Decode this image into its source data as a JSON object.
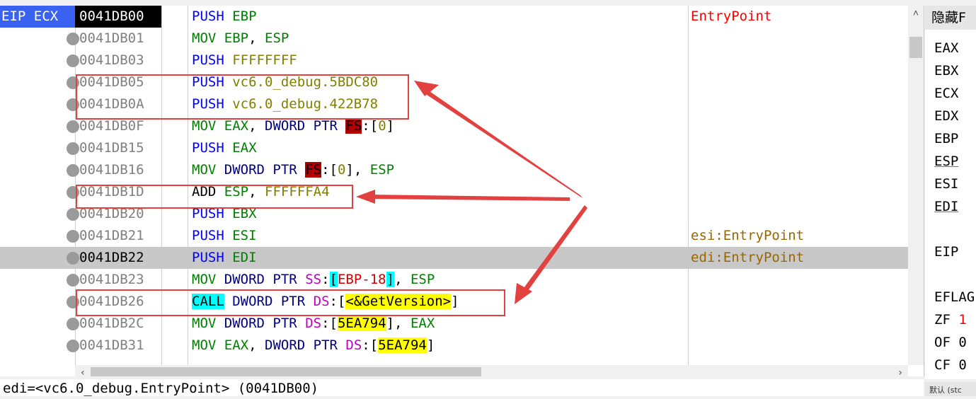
{
  "disasm": {
    "eip_label": "EIP ECX",
    "rows": [
      {
        "addr": "0041DB00",
        "parts": [
          [
            "PUSH",
            "kw"
          ],
          [
            " ",
            "blk"
          ],
          [
            "EBP",
            "reg"
          ]
        ],
        "comment": "EntryPoint",
        "comment_color": "red"
      },
      {
        "addr": "0041DB01",
        "parts": [
          [
            "MOV",
            "reg"
          ],
          [
            " ",
            "blk"
          ],
          [
            "EBP",
            "reg"
          ],
          [
            ", ",
            "blk"
          ],
          [
            "ESP",
            "reg"
          ]
        ],
        "comment": ""
      },
      {
        "addr": "0041DB03",
        "parts": [
          [
            "PUSH",
            "kw"
          ],
          [
            " ",
            "blk"
          ],
          [
            "FFFFFFFF",
            "num"
          ]
        ],
        "comment": ""
      },
      {
        "addr": "0041DB05",
        "parts": [
          [
            "PUSH",
            "kw"
          ],
          [
            " ",
            "blk"
          ],
          [
            "vc6.0_debug.5BDC80",
            "sym"
          ]
        ],
        "comment": ""
      },
      {
        "addr": "0041DB0A",
        "parts": [
          [
            "PUSH",
            "kw"
          ],
          [
            " ",
            "blk"
          ],
          [
            "vc6.0_debug.422B78",
            "sym"
          ]
        ],
        "comment": ""
      },
      {
        "addr": "0041DB0F",
        "parts": [
          [
            "MOV",
            "reg"
          ],
          [
            " ",
            "blk"
          ],
          [
            "EAX",
            "reg"
          ],
          [
            ", ",
            "blk"
          ],
          [
            "DWORD PTR",
            "ptr"
          ],
          [
            " ",
            "blk"
          ],
          [
            "FS",
            "fs"
          ],
          [
            ":[",
            "blk"
          ],
          [
            "0",
            "num"
          ],
          [
            "]",
            "blk"
          ]
        ],
        "comment": ""
      },
      {
        "addr": "0041DB15",
        "parts": [
          [
            "PUSH",
            "kw"
          ],
          [
            " ",
            "blk"
          ],
          [
            "EAX",
            "reg"
          ]
        ],
        "comment": ""
      },
      {
        "addr": "0041DB16",
        "parts": [
          [
            "MOV",
            "reg"
          ],
          [
            " ",
            "blk"
          ],
          [
            "DWORD PTR",
            "ptr"
          ],
          [
            " ",
            "blk"
          ],
          [
            "FS",
            "fs"
          ],
          [
            ":[",
            "blk"
          ],
          [
            "0",
            "num"
          ],
          [
            "], ",
            "blk"
          ],
          [
            "ESP",
            "reg"
          ]
        ],
        "comment": ""
      },
      {
        "addr": "0041DB1D",
        "parts": [
          [
            "ADD",
            "blk"
          ],
          [
            " ",
            "blk"
          ],
          [
            "ESP",
            "reg"
          ],
          [
            ", ",
            "blk"
          ],
          [
            "FFFFFFA4",
            "num"
          ]
        ],
        "comment": ""
      },
      {
        "addr": "0041DB20",
        "parts": [
          [
            "PUSH",
            "kw"
          ],
          [
            " ",
            "blk"
          ],
          [
            "EBX",
            "reg"
          ]
        ],
        "comment": ""
      },
      {
        "addr": "0041DB21",
        "parts": [
          [
            "PUSH",
            "kw"
          ],
          [
            " ",
            "blk"
          ],
          [
            "ESI",
            "reg"
          ]
        ],
        "comment": "esi:EntryPoint",
        "comment_color": "brown"
      },
      {
        "addr": "0041DB22",
        "parts": [
          [
            "PUSH",
            "kw"
          ],
          [
            " ",
            "blk"
          ],
          [
            "EDI",
            "reg"
          ]
        ],
        "comment": "edi:EntryPoint",
        "comment_color": "brown"
      },
      {
        "addr": "0041DB23",
        "parts": [
          [
            "MOV",
            "reg"
          ],
          [
            " ",
            "blk"
          ],
          [
            "DWORD PTR",
            "ptr"
          ],
          [
            " ",
            "blk"
          ],
          [
            "SS",
            "seg"
          ],
          [
            ":",
            "blk"
          ],
          [
            "[",
            "cyan"
          ],
          [
            "EBP-18",
            "imm"
          ],
          [
            "]",
            "cyan"
          ],
          [
            ", ",
            "blk"
          ],
          [
            "ESP",
            "reg"
          ]
        ],
        "comment": ""
      },
      {
        "addr": "0041DB26",
        "parts": [
          [
            "CALL",
            "call"
          ],
          [
            " ",
            "blk"
          ],
          [
            "DWORD PTR",
            "ptr"
          ],
          [
            " ",
            "blk"
          ],
          [
            "DS",
            "seg"
          ],
          [
            ":[",
            "blk"
          ],
          [
            "<&GetVersion>",
            "yel"
          ],
          [
            "]",
            "blk"
          ]
        ],
        "comment": ""
      },
      {
        "addr": "0041DB2C",
        "parts": [
          [
            "MOV",
            "reg"
          ],
          [
            " ",
            "blk"
          ],
          [
            "DWORD PTR",
            "ptr"
          ],
          [
            " ",
            "blk"
          ],
          [
            "DS",
            "seg"
          ],
          [
            ":[",
            "blk"
          ],
          [
            "5EA794",
            "yel"
          ],
          [
            "], ",
            "blk"
          ],
          [
            "EAX",
            "reg"
          ]
        ],
        "comment": ""
      },
      {
        "addr": "0041DB31",
        "parts": [
          [
            "MOV",
            "reg"
          ],
          [
            " ",
            "blk"
          ],
          [
            "EAX",
            "reg"
          ],
          [
            ", ",
            "blk"
          ],
          [
            "DWORD PTR",
            "ptr"
          ],
          [
            " ",
            "blk"
          ],
          [
            "DS",
            "seg"
          ],
          [
            ":[",
            "blk"
          ],
          [
            "5EA794",
            "yel"
          ],
          [
            "]",
            "blk"
          ]
        ],
        "comment": ""
      }
    ]
  },
  "registers": {
    "header": "隐藏F",
    "items": [
      {
        "text": "EAX"
      },
      {
        "text": "EBX"
      },
      {
        "text": "ECX"
      },
      {
        "text": "EDX"
      },
      {
        "text": "EBP"
      },
      {
        "text": "ESP",
        "underline": true
      },
      {
        "text": "ESI"
      },
      {
        "text": "EDI",
        "underline": true
      },
      {
        "text": ""
      },
      {
        "text": "EIP"
      },
      {
        "text": ""
      },
      {
        "text": "EFLAG"
      },
      {
        "text": "ZF",
        "val": "1",
        "val_red": true
      },
      {
        "text": "OF",
        "val": "0"
      },
      {
        "text": "CF",
        "val": "0"
      }
    ]
  },
  "status": {
    "text": "edi=<vc6.0_debug.EntryPoint> (0041DB00)",
    "right": "默认 (stc"
  },
  "colors": {
    "annotation": "#e34040",
    "eip_tag": "#3a62f0",
    "selected_row": "#c8c8c8"
  }
}
